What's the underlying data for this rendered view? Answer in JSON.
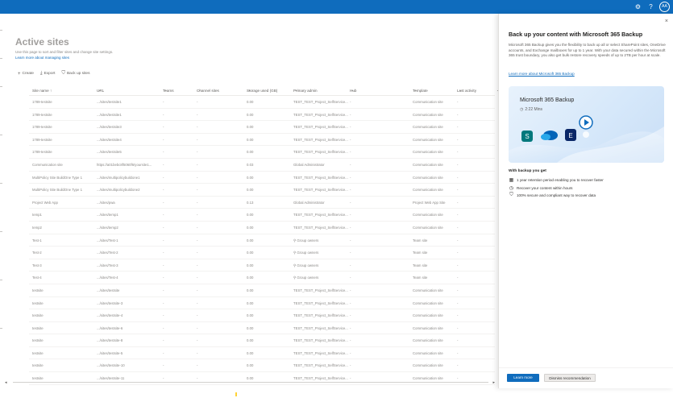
{
  "topbar": {
    "settings_icon": "gear-icon",
    "help_icon": "question-icon",
    "help_label": "?",
    "avatar_initials": "AA"
  },
  "main": {
    "title": "Active sites",
    "description": "Use this page to sort and filter sites and change site settings.",
    "learn_link": "Learn more about managing sites",
    "commands": [
      {
        "label": "Create",
        "icon": "plus-icon"
      },
      {
        "label": "Export",
        "icon": "download-icon"
      },
      {
        "label": "Back up sites",
        "icon": "shield-icon"
      }
    ],
    "columns": [
      "Site name ↑",
      "URL",
      "Teams",
      "Channel sites",
      "Storage used (GB)",
      "Primary admin",
      "Hub",
      "Template",
      "Last activity"
    ],
    "rows": [
      [
        "1789-testsite",
        ".../sites/testsite1",
        "-",
        "-",
        "0.00",
        "TEST_TEST_Project_SelfService...",
        "-",
        "Communication site",
        "-"
      ],
      [
        "1789-testsite",
        ".../sites/testsite1",
        "-",
        "-",
        "0.00",
        "TEST_TEST_Project_SelfService...",
        "-",
        "Communication site",
        "-"
      ],
      [
        "1789-testsite",
        ".../sites/testsite3",
        "-",
        "-",
        "0.00",
        "TEST_TEST_Project_SelfService...",
        "-",
        "Communication site",
        "-"
      ],
      [
        "1789-testsite",
        ".../sites/testsite4",
        "-",
        "-",
        "0.00",
        "TEST_TEST_Project_SelfService...",
        "-",
        "Communication site",
        "-"
      ],
      [
        "1789-testsite",
        ".../sites/testsite5",
        "-",
        "-",
        "0.00",
        "TEST_TEST_Project_SelfService...",
        "-",
        "Communication site",
        "-"
      ],
      [
        "Communication site",
        "https://a01bebc8f5060f6/yoursite1...",
        "-",
        "-",
        "0.03",
        "Global Administrator",
        "-",
        "Communication site",
        "-"
      ],
      [
        "MultiPolicy Site BuildOne Type 1",
        ".../sites/multipolicybuildone1",
        "-",
        "-",
        "0.00",
        "TEST_TEST_Project_SelfService...",
        "-",
        "Communication site",
        "-"
      ],
      [
        "MultiPolicy Site BuildOne Type 1",
        ".../sites/multipolicybuildone2",
        "-",
        "-",
        "0.00",
        "TEST_TEST_Project_SelfService...",
        "-",
        "Communication site",
        "-"
      ],
      [
        "Project Web App",
        ".../sites/pwa",
        "-",
        "-",
        "0.13",
        "Global Administrator",
        "-",
        "Project Web App Site",
        "-"
      ],
      [
        "temp1",
        ".../sites/temp1",
        "-",
        "-",
        "0.00",
        "TEST_TEST_Project_SelfService...",
        "-",
        "Communication site",
        "-"
      ],
      [
        "temp2",
        ".../sites/temp2",
        "-",
        "-",
        "0.00",
        "TEST_TEST_Project_SelfService...",
        "-",
        "Communication site",
        "-"
      ],
      [
        "Test-1",
        ".../sites/Test-1",
        "-",
        "-",
        "0.00",
        "Group owners",
        "-",
        "Team site",
        "-"
      ],
      [
        "Test-2",
        ".../sites/Test-2",
        "-",
        "-",
        "0.00",
        "Group owners",
        "-",
        "Team site",
        "-"
      ],
      [
        "Test-3",
        ".../sites/Test-3",
        "-",
        "-",
        "0.00",
        "Group owners",
        "-",
        "Team site",
        "-"
      ],
      [
        "Test-4",
        ".../sites/Test-4",
        "-",
        "-",
        "0.00",
        "Group owners",
        "-",
        "Team site",
        "-"
      ],
      [
        "testsite",
        ".../sites/testsite",
        "-",
        "-",
        "0.00",
        "TEST_TEST_Project_SelfService...",
        "-",
        "Communication site",
        "-"
      ],
      [
        "testsite",
        ".../sites/testsite-3",
        "-",
        "-",
        "0.00",
        "TEST_TEST_Project_SelfService...",
        "-",
        "Communication site",
        "-"
      ],
      [
        "testsite",
        ".../sites/testsite-4",
        "-",
        "-",
        "0.00",
        "TEST_TEST_Project_SelfService...",
        "-",
        "Communication site",
        "-"
      ],
      [
        "testsite",
        ".../sites/testsite-6",
        "-",
        "-",
        "0.00",
        "TEST_TEST_Project_SelfService...",
        "-",
        "Communication site",
        "-"
      ],
      [
        "testsite",
        ".../sites/testsite-8",
        "-",
        "-",
        "0.00",
        "TEST_TEST_Project_SelfService...",
        "-",
        "Communication site",
        "-"
      ],
      [
        "testsite",
        ".../sites/testsite-5",
        "-",
        "-",
        "0.00",
        "TEST_TEST_Project_SelfService...",
        "-",
        "Communication site",
        "-"
      ],
      [
        "testsite",
        ".../sites/testsite-10",
        "-",
        "-",
        "0.00",
        "TEST_TEST_Project_SelfService...",
        "-",
        "Communication site",
        "-"
      ],
      [
        "testsite",
        ".../sites/testsite-11",
        "-",
        "-",
        "0.00",
        "TEST_TEST_Project_SelfService...",
        "-",
        "Communication site",
        "-"
      ]
    ]
  },
  "panel": {
    "close_icon": "close-icon",
    "close_label": "×",
    "title": "Back up your content with Microsoft 365 Backup",
    "description": "Microsoft 365 Backup gives you the flexibility to back up all or select SharePoint sites, OneDrive accounts, and Exchange mailboxes for up to 1 year. With your data secured within the Microsoft 365 trust boundary, you also get bulk restore recovery speeds of up to 2TB per hour at scale.",
    "learn_link": "Learn more about Microsoft 365 Backup",
    "hero": {
      "title": "Microsoft 365 Backup",
      "duration": "2:22 Mins"
    },
    "with_backup_title": "With backup you get",
    "benefits": [
      {
        "icon": "calendar-icon",
        "text": "1 year retention period enabling you to recover faster"
      },
      {
        "icon": "clock-icon",
        "text": "Recover your content within hours"
      },
      {
        "icon": "shield-check-icon",
        "text": "100% secure and compliant way to recover data"
      }
    ],
    "primary_button": "Learn more",
    "secondary_button": "Dismiss recommendation"
  },
  "colors": {
    "brand": "#0f6cbd",
    "highlight": "#ffd335"
  }
}
